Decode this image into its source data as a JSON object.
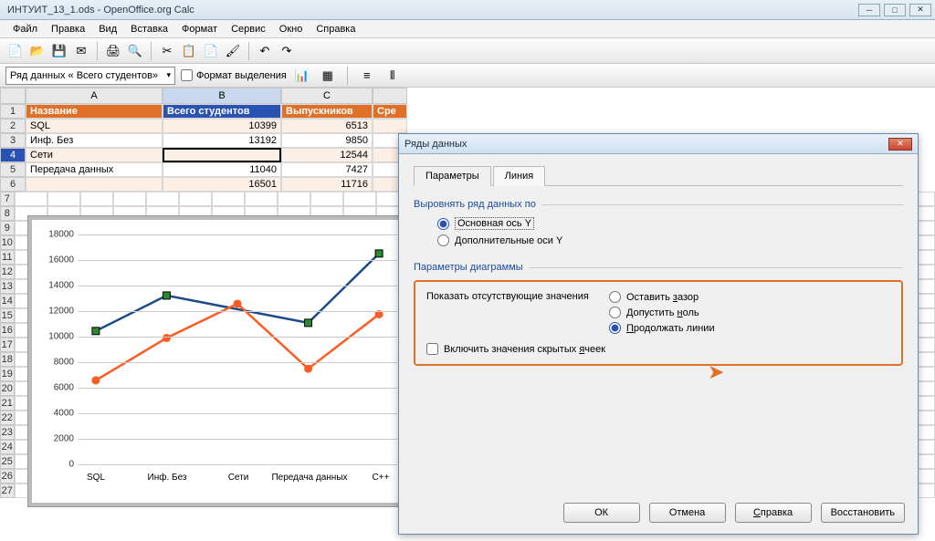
{
  "window": {
    "title": "ИНТУИТ_13_1.ods - OpenOffice.org Calc"
  },
  "menu": {
    "items": [
      "Файл",
      "Правка",
      "Вид",
      "Вставка",
      "Формат",
      "Сервис",
      "Окно",
      "Справка"
    ]
  },
  "fmtbar": {
    "combo": "Ряд данных « Всего студентов»",
    "checkbox_label": "Формат выделения"
  },
  "columns": [
    "A",
    "B",
    "C"
  ],
  "table": {
    "headers": [
      "Название",
      "Всего студентов",
      "Выпускников",
      "Сре"
    ],
    "rows": [
      {
        "n": "2",
        "a": "SQL",
        "b": "10399",
        "c": "6513"
      },
      {
        "n": "3",
        "a": "Инф. Без",
        "b": "13192",
        "c": "9850"
      },
      {
        "n": "4",
        "a": "Сети",
        "b": "",
        "c": "12544"
      },
      {
        "n": "5",
        "a": "Передача данных",
        "b": "11040",
        "c": "7427"
      },
      {
        "n": "6",
        "a": "",
        "b": "16501",
        "c": "11716"
      }
    ]
  },
  "chart_data": {
    "type": "line",
    "categories": [
      "SQL",
      "Инф. Без",
      "Сети",
      "Передача данных",
      "C++"
    ],
    "series": [
      {
        "name": "Всего студентов",
        "color": "#1a4a8a",
        "values": [
          10399,
          13192,
          null,
          11040,
          16501
        ]
      },
      {
        "name": "Выпускников",
        "color": "#ff5a20",
        "values": [
          6513,
          9850,
          12544,
          7427,
          11716
        ]
      }
    ],
    "yTicks": [
      0,
      2000,
      4000,
      6000,
      8000,
      10000,
      12000,
      14000,
      16000,
      18000
    ],
    "ylim": [
      0,
      18000
    ]
  },
  "dialog": {
    "title": "Ряды данных",
    "tabs": [
      "Параметры",
      "Линия"
    ],
    "group1": "Выровнять ряд данных по",
    "g1_opt1": "Основная ось Y",
    "g1_opt2": "Дополнительные оси Y",
    "group2": "Параметры диаграммы",
    "missing_label": "Показать отсутствующие значения",
    "miss_opt1": "Оставить зазор",
    "miss_opt2": "Допустить ноль",
    "miss_opt3": "Продолжать линии",
    "hidden_chk": "Включить значения скрытых ячеек",
    "btns": {
      "ok": "ОК",
      "cancel": "Отмена",
      "help": "Справка",
      "reset": "Восстановить"
    }
  }
}
